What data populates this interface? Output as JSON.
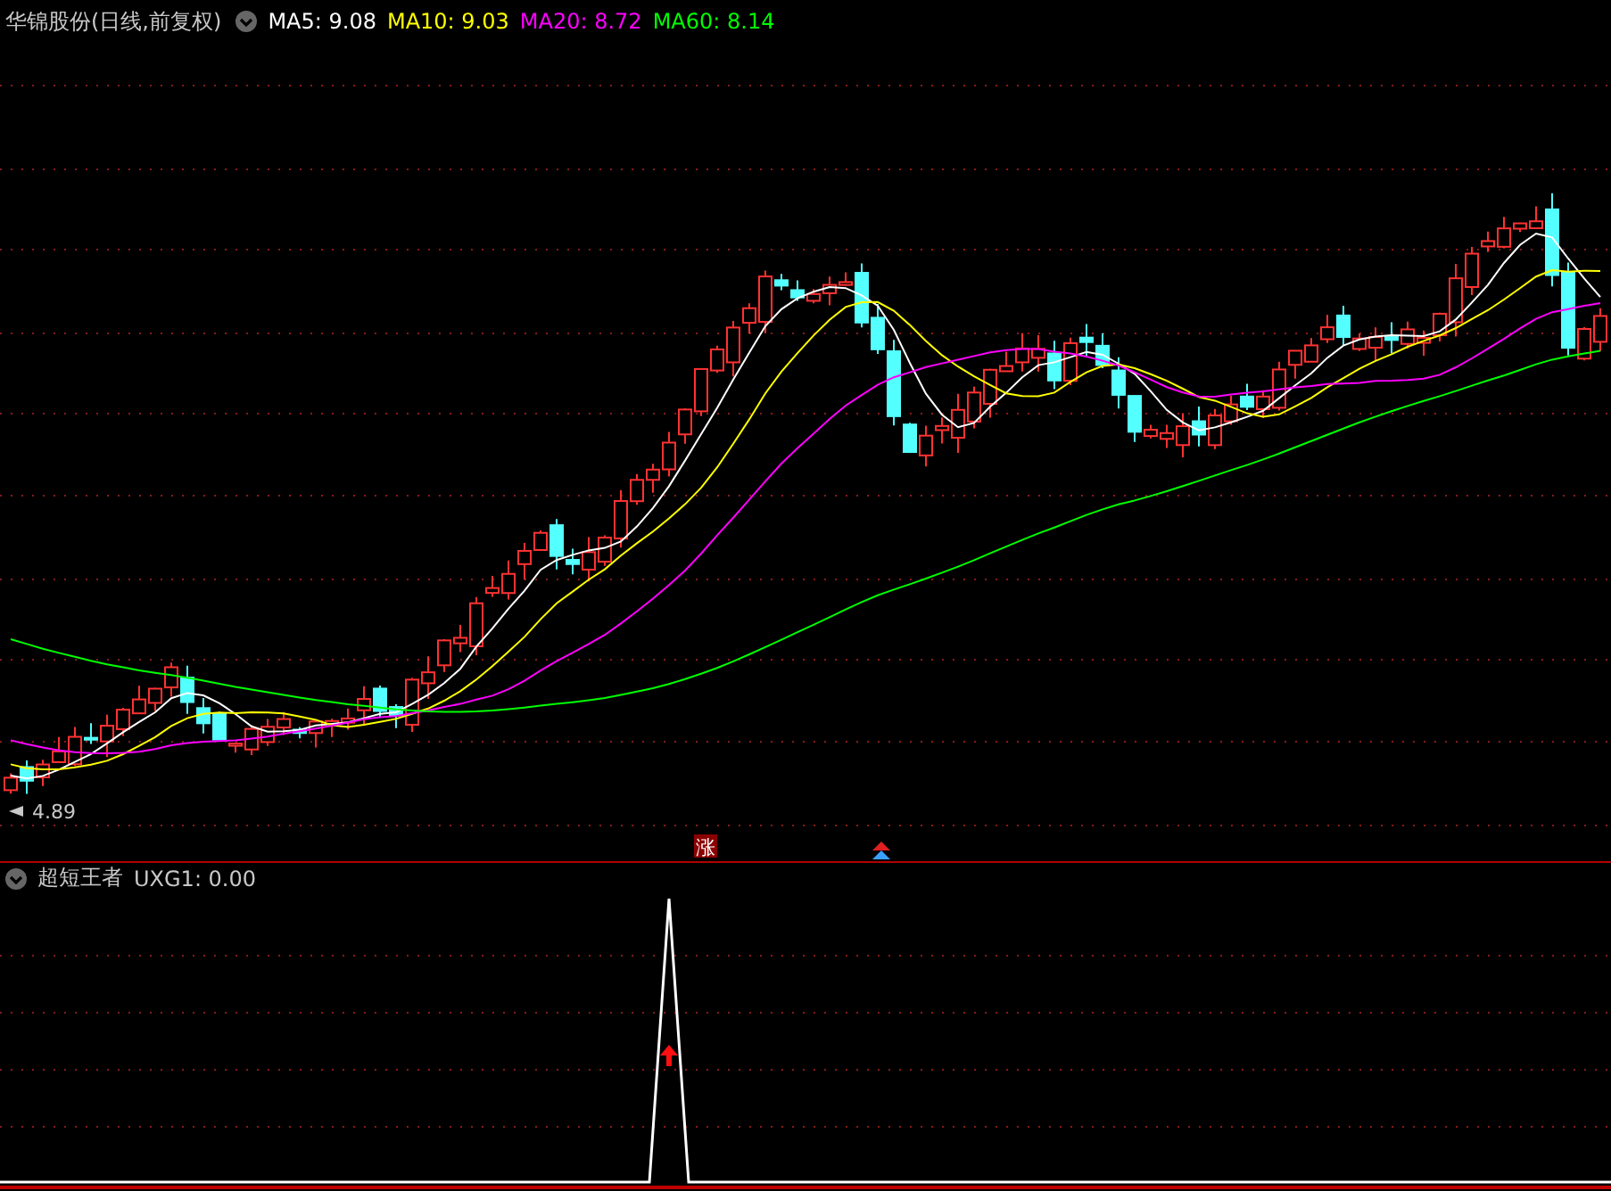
{
  "title": "华锦股份(日线,前复权)",
  "indicators": [
    {
      "label": "MA5: 9.08",
      "color": "#ffffff"
    },
    {
      "label": "MA10: 9.03",
      "color": "#ffff00"
    },
    {
      "label": "MA20: 8.72",
      "color": "#ff00ff"
    },
    {
      "label": "MA60: 8.14",
      "color": "#00ff00"
    }
  ],
  "low_label": "4.89",
  "signal_badge": "涨",
  "sub_panel": {
    "title": "超短王者",
    "reading": "UXG1: 0.00"
  }
}
